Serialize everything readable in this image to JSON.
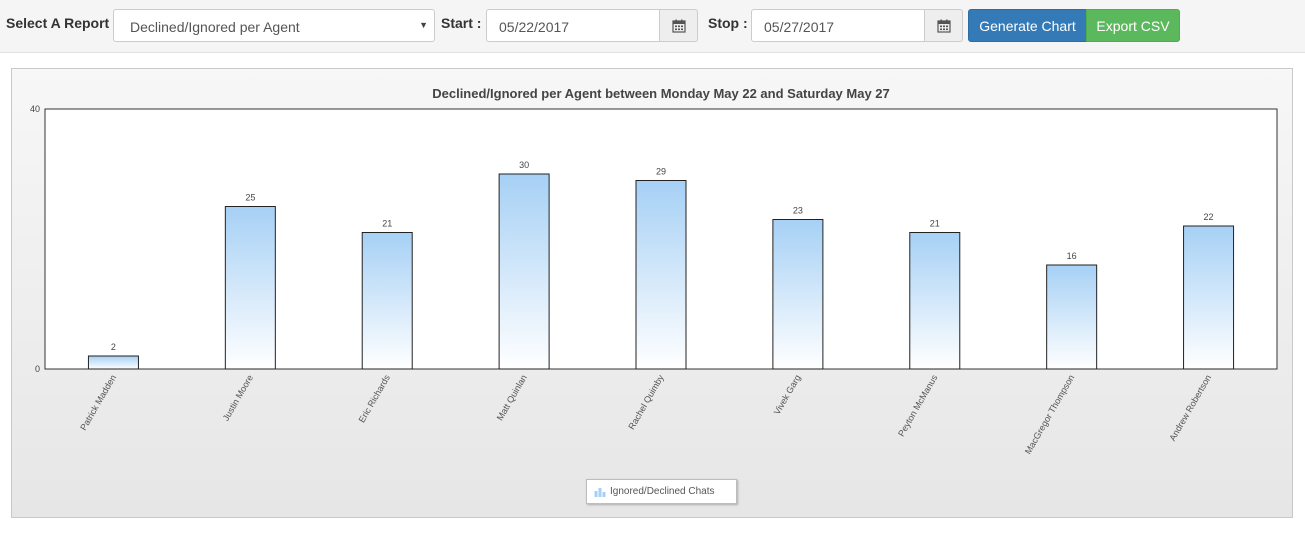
{
  "toolbar": {
    "report_label": "Select A Report",
    "report_value": "Declined/Ignored per Agent",
    "start_label": "Start",
    "start_value": "05/22/2017",
    "stop_label": "Stop",
    "stop_value": "05/27/2017",
    "colon": ":",
    "generate_label": "Generate Chart",
    "export_label": "Export CSV",
    "caret_glyph": "▼",
    "calendar_icon": "calendar-icon"
  },
  "colors": {
    "primary": "#337ab7",
    "success": "#5cb85c",
    "bar_top": "#a6d0f5",
    "bar_bottom": "#ffffff"
  },
  "legend": {
    "label": "Ignored/Declined Chats",
    "icon": "bar-chart-icon"
  },
  "chart_data": {
    "type": "bar",
    "title": "Declined/Ignored per Agent between Monday May 22 and Saturday May 27",
    "categories": [
      "Patrick Madden",
      "Justin Moore",
      "Eric Richards",
      "Matt Quinlan",
      "Rachel Quimby",
      "Vivek Garg",
      "Peyton McManus",
      "MacGregor Thompson",
      "Andrew Robertson"
    ],
    "series": [
      {
        "name": "Ignored/Declined Chats",
        "values": [
          2,
          25,
          21,
          30,
          29,
          23,
          21,
          16,
          22
        ]
      }
    ],
    "ylim": [
      0,
      40
    ],
    "yticks": [
      0,
      40
    ],
    "xlabel": "",
    "ylabel": "",
    "grid": false,
    "legend_position": "bottom"
  }
}
